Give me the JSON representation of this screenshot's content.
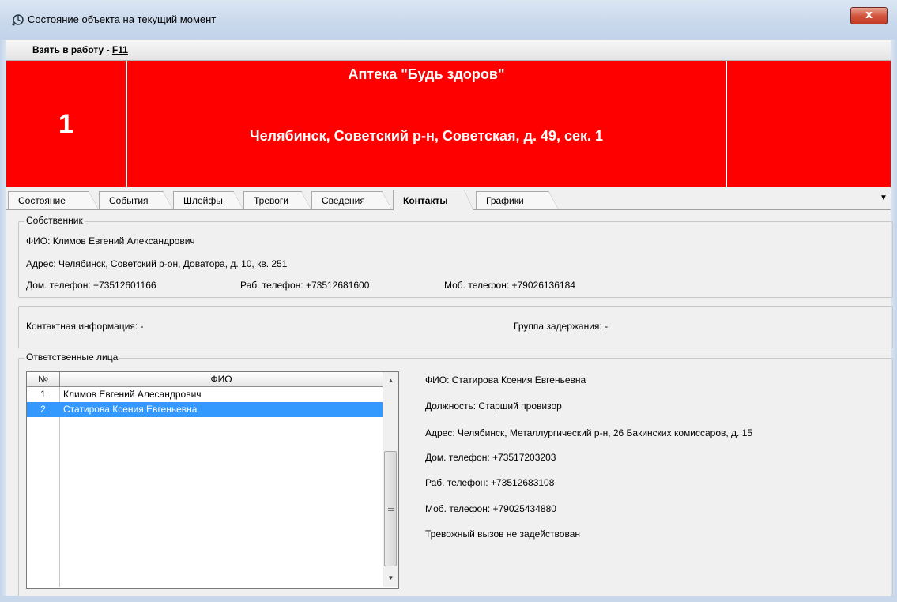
{
  "window": {
    "title": "Состояние объекта на текущий момент",
    "close_label": "x"
  },
  "toolbar": {
    "take_label": "Взять в работу - ",
    "take_hotkey": "F11"
  },
  "object": {
    "number": "1",
    "name": "Аптека \"Будь здоров\"",
    "address": "Челябинск, Советский р-н, Советская, д. 49, сек. 1",
    "status_color": "#ff0000"
  },
  "tabs": [
    {
      "label": "Состояние"
    },
    {
      "label": "События"
    },
    {
      "label": "Шлейфы"
    },
    {
      "label": "Тревоги"
    },
    {
      "label": "Сведения"
    },
    {
      "label": "Контакты"
    },
    {
      "label": "Графики"
    }
  ],
  "active_tab": "Контакты",
  "owner": {
    "title": "Собственник",
    "fio": "ФИО: Климов Евгений Александрович",
    "address": "Адрес:  Челябинск, Советский р-он, Доватора, д. 10, кв. 251",
    "home_phone": "Дом. телефон: +73512601166",
    "work_phone": "Раб. телефон: +73512681600",
    "mobile_phone": "Моб. телефон: +79026136184"
  },
  "contact_info": {
    "label": "Контактная информация:  -",
    "group_label": "Группа задержания:  -"
  },
  "responsible": {
    "title": "Ответственные лица",
    "columns": [
      "№",
      "ФИО"
    ],
    "rows": [
      {
        "num": "1",
        "fio": "Климов Евгений Алесандрович"
      },
      {
        "num": "2",
        "fio": "Статирова Ксения Евгеньевна"
      }
    ],
    "selected_row": 2,
    "details": {
      "fio": "ФИО:  Статирова Ксения Евгеньевна",
      "position": "Должность:  Старший провизор",
      "address": "Адрес:  Челябинск, Металлургический р-н, 26 Бакинских комиссаров, д. 15",
      "home_phone": "Дом. телефон:  +73517203203",
      "work_phone": "Раб. телефон:  +73512683108",
      "mobile_phone": "Моб. телефон:  +79025434880",
      "alarm_note": " Тревожный вызов не задействован"
    }
  }
}
